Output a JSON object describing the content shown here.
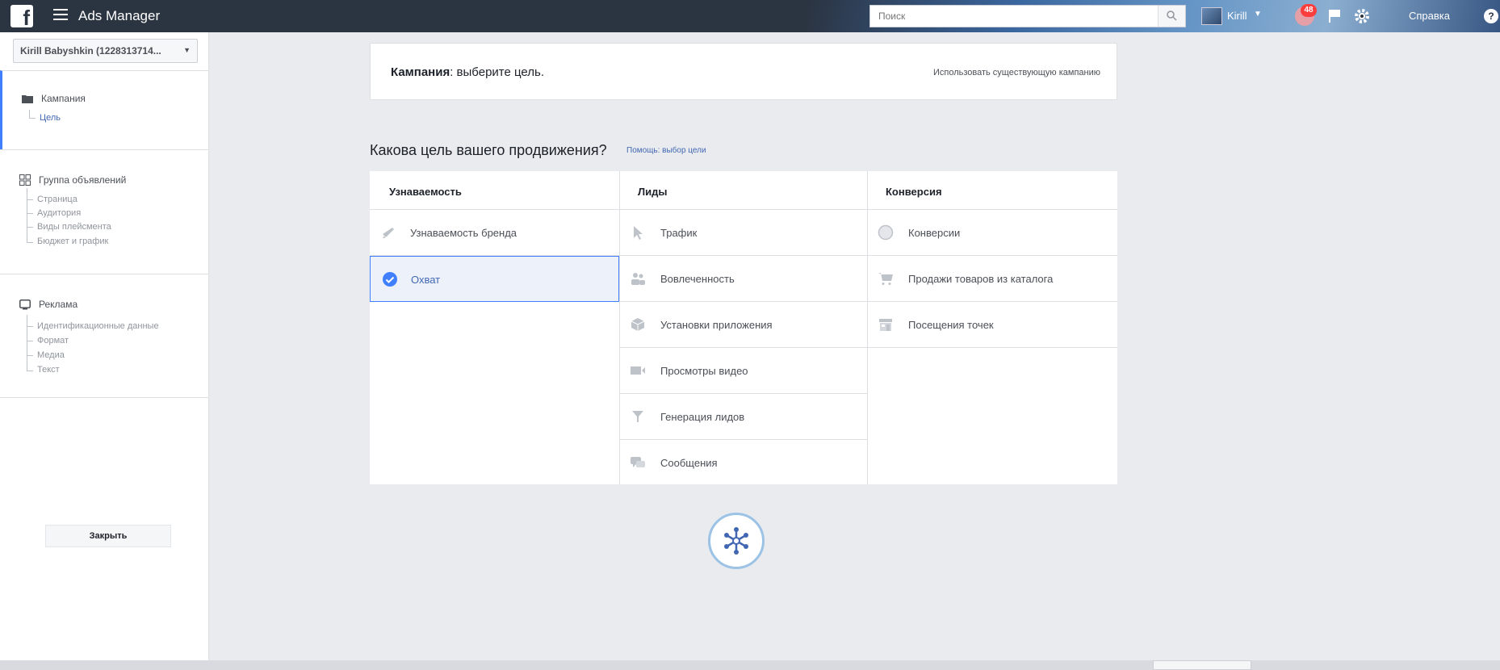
{
  "topbar": {
    "app_title": "Ads Manager",
    "search_placeholder": "Поиск",
    "user_name": "Kirill",
    "notifications_count": "48",
    "help_label": "Справка"
  },
  "sidebar": {
    "account": "Kirill Babyshkin (1228313714...",
    "campaign": {
      "label": "Кампания",
      "items": [
        "Цель"
      ]
    },
    "adset": {
      "label": "Группа объявлений",
      "items": [
        "Страница",
        "Аудитория",
        "Виды плейсмента",
        "Бюджет и график"
      ]
    },
    "ad": {
      "label": "Реклама",
      "items": [
        "Идентификационные данные",
        "Формат",
        "Медиа",
        "Текст"
      ]
    },
    "close_label": "Закрыть"
  },
  "campaign_card": {
    "title_bold": "Кампания",
    "title_rest": ": выберите цель.",
    "use_existing": "Использовать существующую кампанию"
  },
  "question": {
    "title": "Какова цель вашего продвижения?",
    "help_link": "Помощь: выбор цели"
  },
  "objectives": {
    "columns": [
      {
        "heading": "Узнаваемость",
        "items": [
          {
            "label": "Узнаваемость бренда",
            "icon": "megaphone-icon"
          },
          {
            "label": "Охват",
            "icon": "check-circle-icon",
            "selected": true
          }
        ]
      },
      {
        "heading": "Лиды",
        "items": [
          {
            "label": "Трафик",
            "icon": "cursor-icon"
          },
          {
            "label": "Вовлеченность",
            "icon": "people-icon"
          },
          {
            "label": "Установки приложения",
            "icon": "box-icon"
          },
          {
            "label": "Просмотры видео",
            "icon": "video-icon"
          },
          {
            "label": "Генерация лидов",
            "icon": "funnel-icon"
          },
          {
            "label": "Сообщения",
            "icon": "chat-icon"
          }
        ]
      },
      {
        "heading": "Конверсия",
        "items": [
          {
            "label": "Конверсии",
            "icon": "globe-icon"
          },
          {
            "label": "Продажи товаров из каталога",
            "icon": "cart-icon"
          },
          {
            "label": "Посещения точек",
            "icon": "store-icon"
          }
        ]
      }
    ]
  },
  "colors": {
    "topbar": "#2b3441",
    "accent": "#4267b2",
    "selected_border": "#4080ff",
    "badge": "#fa3e3e"
  }
}
